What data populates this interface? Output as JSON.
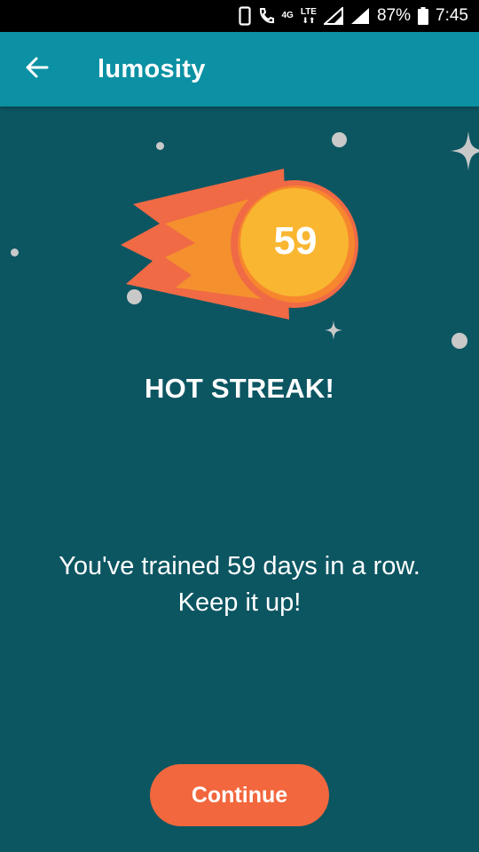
{
  "status_bar": {
    "network_label": "4G",
    "lte_label": "LTE",
    "battery_percent": "87%",
    "time": "7:45",
    "icons": [
      "phone-outline-icon",
      "call-icon",
      "signal-icon",
      "signal-icon",
      "battery-icon"
    ]
  },
  "app_bar": {
    "title": "lumosity",
    "back_icon": "back-arrow-icon"
  },
  "streak": {
    "days": "59",
    "headline": "HOT STREAK!",
    "message": "You've trained 59 days in a row. Keep it up!"
  },
  "actions": {
    "continue_label": "Continue"
  },
  "colors": {
    "background": "#0c5662",
    "app_bar": "#0b91a3",
    "button": "#f2673d",
    "comet_outer": "#ef6a45",
    "comet_inner": "#f5902e",
    "sun": "#f9b631"
  }
}
